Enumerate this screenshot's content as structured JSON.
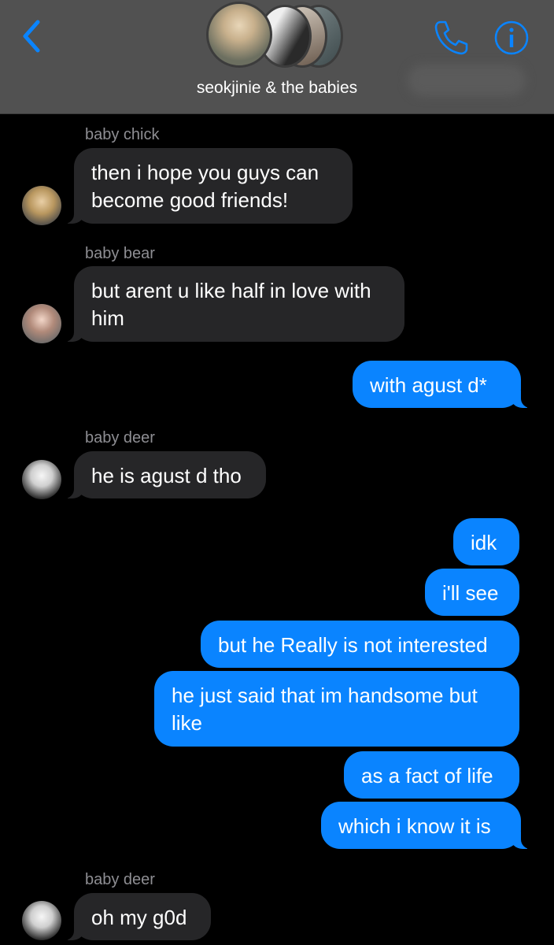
{
  "header": {
    "back_icon": "chevron-left-icon",
    "title": "seokjinie & the babies",
    "phone_icon": "phone-icon",
    "info_icon": "info-icon",
    "accent_color": "#0a84ff"
  },
  "messages": [
    {
      "type": "received",
      "sender": "baby chick",
      "text": "then i hope you guys can\nbecome good friends!"
    },
    {
      "type": "received",
      "sender": "baby bear",
      "text": "but arent u like half in love with\nhim"
    },
    {
      "type": "sent",
      "text": "with agust d*"
    },
    {
      "type": "received",
      "sender": "baby deer",
      "text": "he is agust d tho"
    },
    {
      "type": "sent",
      "text": "idk"
    },
    {
      "type": "sent",
      "text": "i'll see"
    },
    {
      "type": "sent",
      "text": "but he Really is not interested"
    },
    {
      "type": "sent",
      "text": "he just said that im handsome but\nlike"
    },
    {
      "type": "sent",
      "text": "as a fact of life"
    },
    {
      "type": "sent",
      "text": "which i know it is"
    },
    {
      "type": "received",
      "sender": "baby deer",
      "text": "oh my g0d"
    }
  ]
}
